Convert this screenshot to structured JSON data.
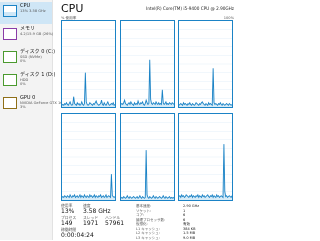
{
  "sidebar": {
    "items": [
      {
        "title": "CPU",
        "sub": "13% 3.58 GHz",
        "sub2": ""
      },
      {
        "title": "メモリ",
        "sub": "4.2/15.9 GB (26%)",
        "sub2": ""
      },
      {
        "title": "ディスク 0 (C:)",
        "sub": "SSD (NVMe)",
        "sub2": "0%"
      },
      {
        "title": "ディスク 1 (D:)",
        "sub": "HDD",
        "sub2": "0%"
      },
      {
        "title": "GPU 0",
        "sub": "NVIDIA GeForce GTX 1660 Ti",
        "sub2": "3%"
      }
    ]
  },
  "header": {
    "title": "CPU",
    "model": "Intel(R) Core(TM) i5-9400 CPU @ 2.90GHz",
    "util_label": "% 使用率",
    "util_max": "100%"
  },
  "graph": {
    "color": "#1b83c6",
    "fill": "#d6ebf7",
    "cores": [
      {
        "core": 1,
        "samples": [
          2,
          3,
          2,
          4,
          3,
          5,
          3,
          2,
          4,
          6,
          3,
          2,
          3,
          12,
          4,
          3,
          2,
          5,
          3,
          4,
          2,
          3,
          6,
          3,
          2,
          4,
          40,
          6,
          3,
          2,
          3,
          5,
          4,
          3,
          2,
          4,
          3,
          5,
          7,
          4,
          3,
          2,
          3,
          4,
          8,
          3,
          2,
          5,
          3,
          2,
          4,
          6,
          3,
          2,
          3,
          4,
          3,
          5,
          2,
          3
        ]
      },
      {
        "core": 2,
        "samples": [
          3,
          4,
          3,
          5,
          8,
          4,
          3,
          2,
          4,
          5,
          3,
          6,
          4,
          3,
          2,
          5,
          3,
          4,
          3,
          7,
          4,
          3,
          5,
          4,
          6,
          3,
          2,
          4,
          8,
          5,
          3,
          4,
          55,
          9,
          4,
          3,
          5,
          4,
          3,
          6,
          4,
          3,
          5,
          3,
          4,
          3,
          20,
          5,
          3,
          4,
          6,
          3,
          4,
          3,
          5,
          4,
          3,
          5,
          4,
          3
        ]
      },
      {
        "core": 3,
        "samples": [
          2,
          3,
          4,
          3,
          2,
          5,
          3,
          4,
          3,
          2,
          4,
          3,
          5,
          3,
          2,
          4,
          3,
          2,
          3,
          5,
          4,
          3,
          2,
          4,
          3,
          5,
          6,
          4,
          3,
          2,
          4,
          3,
          2,
          5,
          3,
          4,
          3,
          2,
          45,
          5,
          3,
          4,
          3,
          2,
          4,
          3,
          5,
          3,
          2,
          4,
          3,
          2,
          3,
          4,
          3,
          2,
          4,
          3,
          2,
          3
        ]
      },
      {
        "core": 4,
        "samples": [
          3,
          4,
          3,
          5,
          4,
          3,
          5,
          4,
          3,
          6,
          4,
          3,
          5,
          4,
          6,
          3,
          4,
          5,
          3,
          4,
          6,
          3,
          5,
          4,
          3,
          6,
          4,
          3,
          5,
          4,
          3,
          6,
          4,
          5,
          3,
          4,
          6,
          3,
          5,
          4,
          3,
          5,
          4,
          6,
          3,
          4,
          5,
          3,
          4,
          6,
          3,
          4,
          5,
          4,
          3,
          30,
          5,
          4,
          3,
          4
        ]
      },
      {
        "core": 5,
        "samples": [
          2,
          3,
          2,
          4,
          3,
          2,
          3,
          5,
          3,
          2,
          4,
          3,
          2,
          3,
          4,
          3,
          2,
          3,
          4,
          2,
          3,
          5,
          3,
          2,
          4,
          3,
          2,
          3,
          58,
          6,
          3,
          2,
          4,
          3,
          2,
          3,
          5,
          3,
          2,
          4,
          3,
          2,
          3,
          4,
          3,
          2,
          3,
          5,
          3,
          2,
          4,
          3,
          2,
          3,
          4,
          2,
          3,
          2,
          3,
          2
        ]
      },
      {
        "core": 6,
        "samples": [
          4,
          5,
          3,
          6,
          4,
          5,
          3,
          4,
          6,
          5,
          4,
          3,
          5,
          4,
          6,
          3,
          5,
          4,
          3,
          5,
          4,
          6,
          3,
          5,
          4,
          3,
          6,
          4,
          5,
          3,
          4,
          5,
          6,
          4,
          3,
          5,
          4,
          6,
          3,
          5,
          4,
          3,
          6,
          4,
          5,
          3,
          4,
          5,
          4,
          3,
          65,
          10,
          4,
          5,
          3,
          4,
          5,
          4,
          3,
          5
        ]
      }
    ]
  },
  "stats": {
    "util_label": "使用率",
    "util_val": "13%",
    "speed_label": "速度",
    "speed_val": "3.58 GHz",
    "proc_label": "プロセス",
    "proc_val": "149",
    "thread_label": "スレッド",
    "thread_val": "1971",
    "handle_label": "ハンドル",
    "handle_val": "57961",
    "uptime_label": "稼働時間",
    "uptime_val": "0:00:04:24",
    "details": [
      {
        "label": "基本速度:",
        "value": "2.90 GHz"
      },
      {
        "label": "ソケット:",
        "value": "1"
      },
      {
        "label": "コア:",
        "value": "6"
      },
      {
        "label": "論理プロセッサ数:",
        "value": "6"
      },
      {
        "label": "仮想化:",
        "value": "有効"
      },
      {
        "label": "L1 キャッシュ:",
        "value": "384 KB"
      },
      {
        "label": "L2 キャッシュ:",
        "value": "1.5 MB"
      },
      {
        "label": "L3 キャッシュ:",
        "value": "9.0 MB"
      }
    ]
  }
}
